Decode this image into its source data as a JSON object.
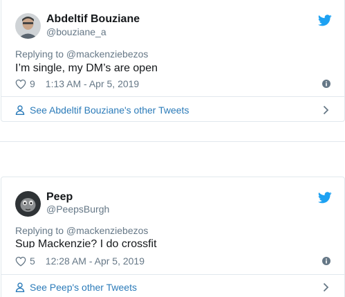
{
  "tweets": [
    {
      "name": "Abdeltif Bouziane",
      "handle": "@bouziane_a",
      "replying": "Replying to @mackenziebezos",
      "text": "I’m single, my DM’s are open",
      "likes": "9",
      "timestamp": "1:13 AM - Apr 5, 2019",
      "other_link": "See Abdeltif Bouziane's other Tweets"
    },
    {
      "name": "Peep",
      "handle": "@PeepsBurgh",
      "replying": "Replying to @mackenziebezos",
      "text": "Sup Mackenzie? I do crossfit",
      "likes": "5",
      "timestamp": "12:28 AM - Apr 5, 2019",
      "other_link": "See Peep's other Tweets"
    }
  ],
  "colors": {
    "twitter_blue": "#1da1f2",
    "link": "#2b7bb9",
    "muted": "#657786",
    "border": "#e1e8ed"
  },
  "icons": [
    "twitter-bird-icon",
    "heart-icon",
    "info-icon",
    "person-icon",
    "chevron-right-icon"
  ]
}
